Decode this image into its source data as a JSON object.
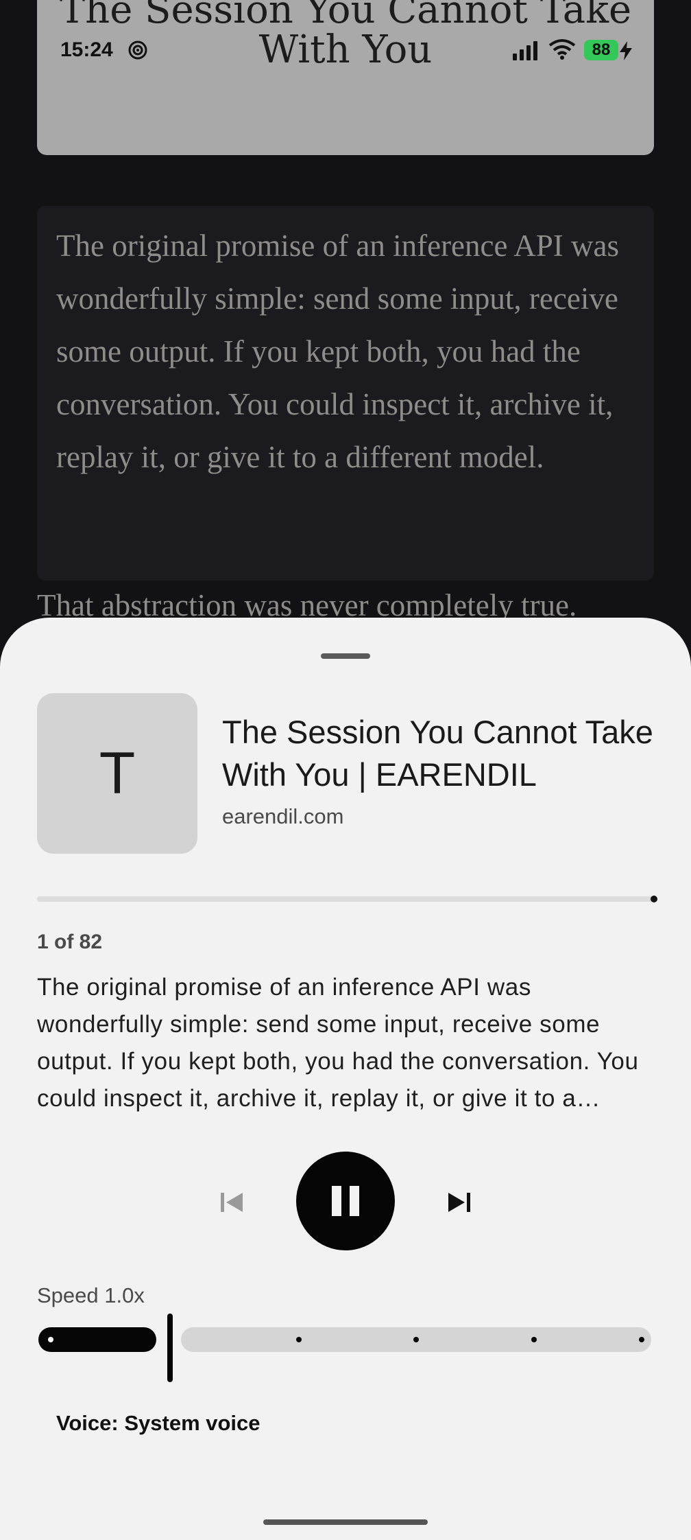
{
  "article": {
    "hero_title": "The Session You Cannot Take With You",
    "quote_text": "The original promise of an inference API was wonderfully simple: send some input, receive some output. If you kept both, you had the conversation. You could inspect it, archive it, replay it, or give it to a different model.",
    "next_line": "That abstraction was never completely true."
  },
  "status_bar": {
    "time": "15:24",
    "battery": "88"
  },
  "player": {
    "thumbnail_letter": "T",
    "title": "The Session You Cannot Take With You | EARENDIL",
    "domain": "earendil.com",
    "progress_fraction": 1.0,
    "counter": "1 of 82",
    "snippet": "The original promise of an inference API was wonderfully simple: send some input, receive some output. If you kept both, you had the conversation. You could inspect it, archive it, replay it, or give it to a different model.",
    "state": "playing",
    "speed_label": "Speed 1.0x",
    "speed_value": 1.0,
    "speed_steps": 5,
    "speed_index": 1,
    "voice_label": "Voice: System voice"
  },
  "icons": {
    "previous": "skip-previous-icon",
    "play_pause": "pause-icon",
    "next": "skip-next-icon"
  },
  "colors": {
    "sheet_bg": "#f2f2f2",
    "battery": "#34c759",
    "accent": "#050505"
  }
}
